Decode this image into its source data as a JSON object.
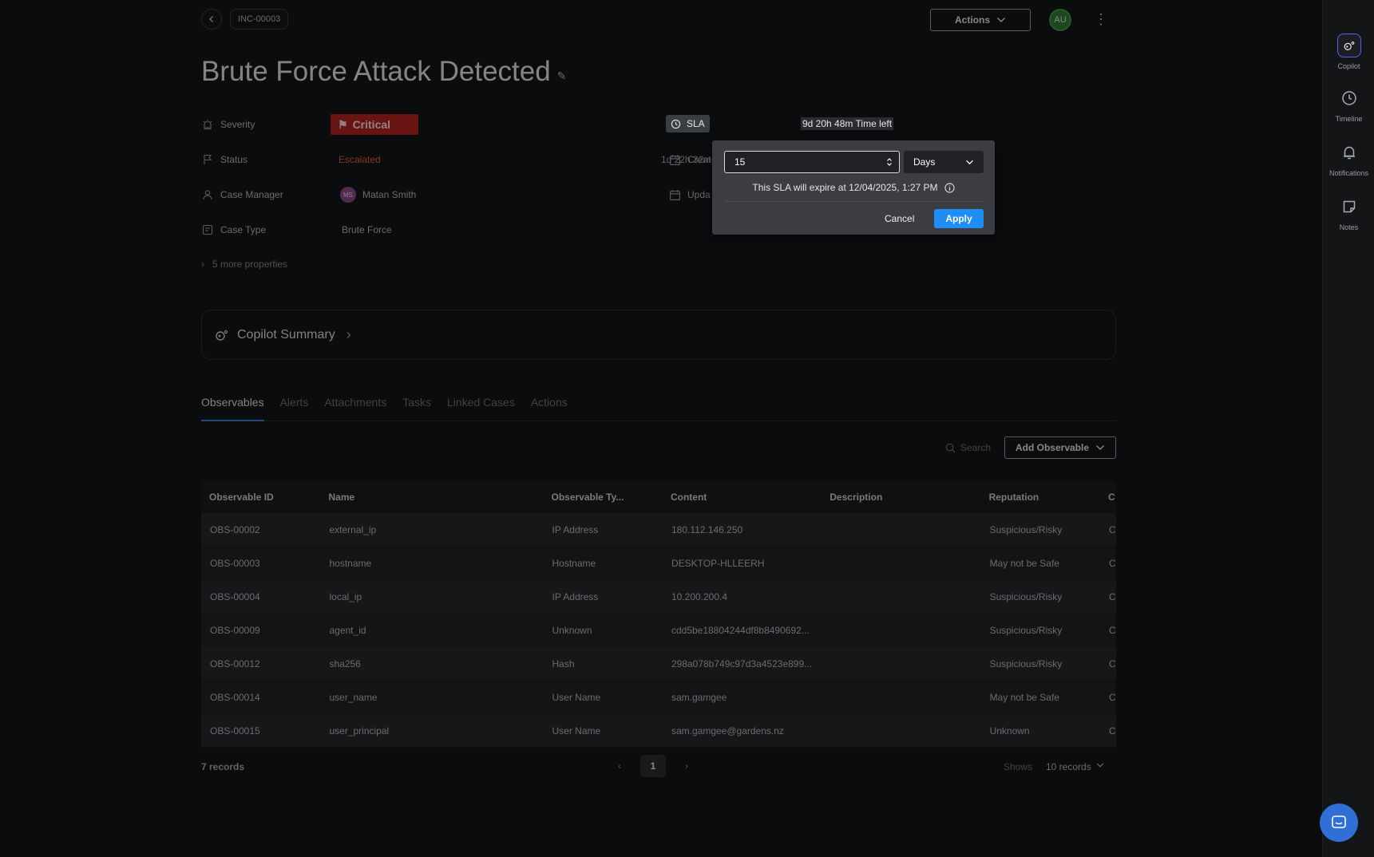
{
  "header": {
    "incident_id": "INC-00003",
    "actions_label": "Actions",
    "user_initials": "AU",
    "title": "Brute Force Attack Detected"
  },
  "properties": {
    "severity_label": "Severity",
    "severity_value": "Critical",
    "status_label": "Status",
    "status_value": "Escalated",
    "status_time": "1d 22h 32m",
    "manager_label": "Case Manager",
    "manager_initials": "MS",
    "manager_name": "Matan Smith",
    "type_label": "Case Type",
    "type_value": "Brute Force",
    "more": "5 more properties"
  },
  "sla": {
    "label": "SLA",
    "time_left": "9d 20h 48m",
    "time_left_suffix": "Time left",
    "created_label": "Creat",
    "updated_label": "Upda"
  },
  "sla_popover": {
    "value": "15",
    "unit": "Days",
    "expire_text": "This SLA will expire at 12/04/2025, 1:27 PM",
    "cancel": "Cancel",
    "apply": "Apply"
  },
  "copilot_summary": "Copilot Summary",
  "tabs": [
    "Observables",
    "Alerts",
    "Attachments",
    "Tasks",
    "Linked Cases",
    "Actions"
  ],
  "toolbar": {
    "search_placeholder": "Search",
    "add_label": "Add Observable"
  },
  "table": {
    "columns": [
      "Observable ID",
      "Name",
      "Observable Ty...",
      "Content",
      "Description",
      "Reputation",
      "C"
    ],
    "rows": [
      {
        "id": "OBS-00002",
        "name": "external_ip",
        "type": "IP Address",
        "content": "180.112.146.250",
        "description": "",
        "reputation": "Suspicious/Risky",
        "extra": "C"
      },
      {
        "id": "OBS-00003",
        "name": "hostname",
        "type": "Hostname",
        "content": "DESKTOP-HLLEERH",
        "description": "",
        "reputation": "May not be Safe",
        "extra": "C"
      },
      {
        "id": "OBS-00004",
        "name": "local_ip",
        "type": "IP Address",
        "content": "10.200.200.4",
        "description": "",
        "reputation": "Suspicious/Risky",
        "extra": "C"
      },
      {
        "id": "OBS-00009",
        "name": "agent_id",
        "type": "Unknown",
        "content": "cdd5be18804244df8b8490692...",
        "description": "",
        "reputation": "Suspicious/Risky",
        "extra": "C"
      },
      {
        "id": "OBS-00012",
        "name": "sha256",
        "type": "Hash",
        "content": "298a078b749c97d3a4523e899...",
        "description": "",
        "reputation": "Suspicious/Risky",
        "extra": "C"
      },
      {
        "id": "OBS-00014",
        "name": "user_name",
        "type": "User Name",
        "content": "sam.gamgee",
        "description": "",
        "reputation": "May not be Safe",
        "extra": "C"
      },
      {
        "id": "OBS-00015",
        "name": "user_principal",
        "type": "User Name",
        "content": "sam.gamgee@gardens.nz",
        "description": "",
        "reputation": "Unknown",
        "extra": "C"
      }
    ]
  },
  "footer": {
    "records": "7 records",
    "page": "1",
    "shows_label": "Shows",
    "per_page": "10 records"
  },
  "rail": {
    "copilot": "Copilot",
    "timeline": "Timeline",
    "notifications": "Notifications",
    "notes": "Notes"
  },
  "colors": {
    "critical": "#b1231f",
    "escalated": "#e0622d",
    "apply": "#1e8df5",
    "tab_active": "#3b82d6"
  }
}
